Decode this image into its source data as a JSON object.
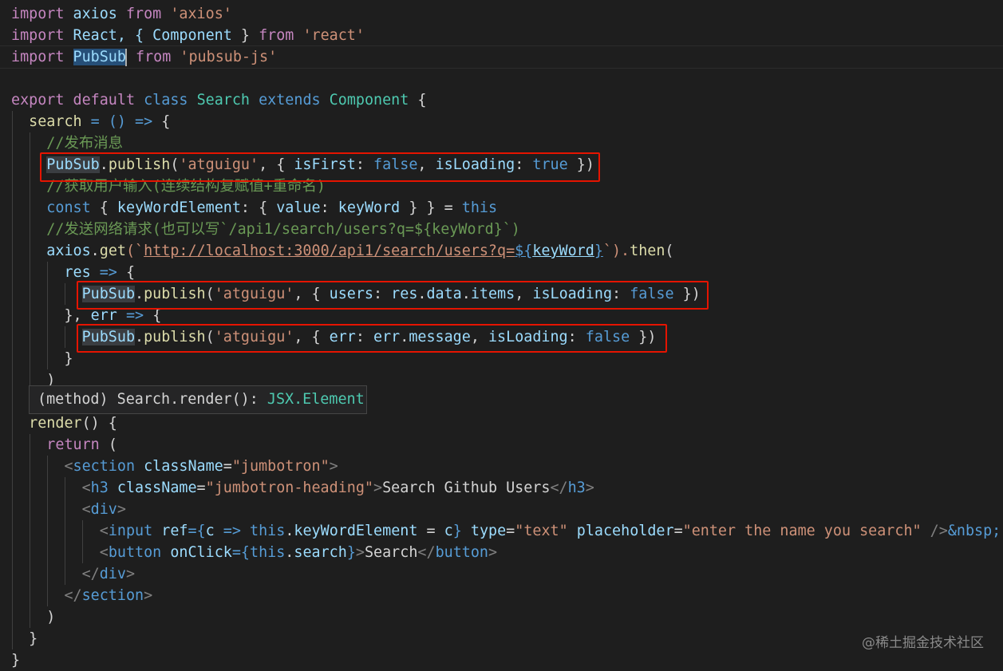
{
  "editor": {
    "lines": {
      "l1": [
        "import",
        "axios",
        "from",
        "'axios'"
      ],
      "l2": [
        "import",
        "React, {",
        "Component",
        "}",
        "from",
        "'react'"
      ],
      "l3": [
        "import",
        "PubSub",
        "from",
        "'pubsub-js'"
      ],
      "l5": [
        "export",
        "default",
        "class",
        "Search",
        "extends",
        "Component",
        "{"
      ],
      "l6": [
        "search",
        "= () =>",
        "{"
      ],
      "l7": "//发布消息",
      "l8": [
        "PubSub",
        ".",
        "publish",
        "(",
        "'atguigu'",
        ", { ",
        "isFirst",
        ": ",
        "false",
        ", ",
        "isLoading",
        ": ",
        "true",
        " })"
      ],
      "l9": "//获取用户输入(连续结构复赋值+重命名)",
      "l10": [
        "const",
        "{ ",
        "keyWordElement",
        ": { ",
        "value",
        ": ",
        "keyWord",
        " } } = ",
        "this"
      ],
      "l11": "//发送网络请求(也可以写`/api1/search/users?q=${keyWord}`)",
      "l12": [
        "axios",
        ".",
        "get",
        "(`",
        "http://localhost:3000/api1/search/users?q=",
        "${",
        "keyWord",
        "}",
        "`).",
        "then",
        "("
      ],
      "l13": [
        "res",
        "=>",
        "{"
      ],
      "l14": [
        "PubSub",
        ".",
        "publish",
        "(",
        "'atguigu'",
        ", { ",
        "users",
        ": ",
        "res",
        ".",
        "data",
        ".",
        "items",
        ", ",
        "isLoading",
        ": ",
        "false",
        " })"
      ],
      "l15": [
        "}, ",
        "err",
        "=>",
        "{"
      ],
      "l16": [
        "PubSub",
        ".",
        "publish",
        "(",
        "'atguigu'",
        ", { ",
        "err",
        ": ",
        "err",
        ".",
        "message",
        ", ",
        "isLoading",
        ": ",
        "false",
        " })"
      ],
      "l17": "}",
      "l18": ")",
      "l20": [
        "render",
        "() {"
      ],
      "l21": [
        "return",
        "("
      ],
      "l22": [
        "<",
        "section",
        "className",
        "=",
        "\"jumbotron\"",
        ">"
      ],
      "l23": [
        "<",
        "h3",
        "className",
        "=",
        "\"jumbotron-heading\"",
        ">",
        "Search Github Users",
        "</",
        "h3",
        ">"
      ],
      "l24": [
        "<",
        "div",
        ">"
      ],
      "l25": [
        "<",
        "input",
        "ref",
        "={",
        "c",
        "=>",
        "this",
        ".",
        "keyWordElement",
        " = ",
        "c",
        "}",
        "type",
        "=",
        "\"text\"",
        "placeholder",
        "=",
        "\"enter the name you search\"",
        " />",
        "&nbsp;"
      ],
      "l26": [
        "<",
        "button",
        "onClick",
        "={",
        "this",
        ".",
        "search",
        "}",
        ">",
        "Search",
        "</",
        "button",
        ">"
      ],
      "l27": [
        "</",
        "div",
        ">"
      ],
      "l28": [
        "</",
        "section",
        ">"
      ],
      "l29": ")",
      "l30": "}",
      "l31": "}"
    }
  },
  "hover": {
    "prefix": "(method) Search.render(): ",
    "type": "JSX.Element"
  },
  "watermark": "@稀土掘金技术社区",
  "colors": {
    "background": "#1e1e1e",
    "highlight_box": "#e51400",
    "keyword": "#569cd6",
    "string": "#ce9178",
    "comment": "#6a9955",
    "type": "#4ec9b0",
    "variable": "#9cdcfe",
    "function": "#dcdcaa"
  }
}
